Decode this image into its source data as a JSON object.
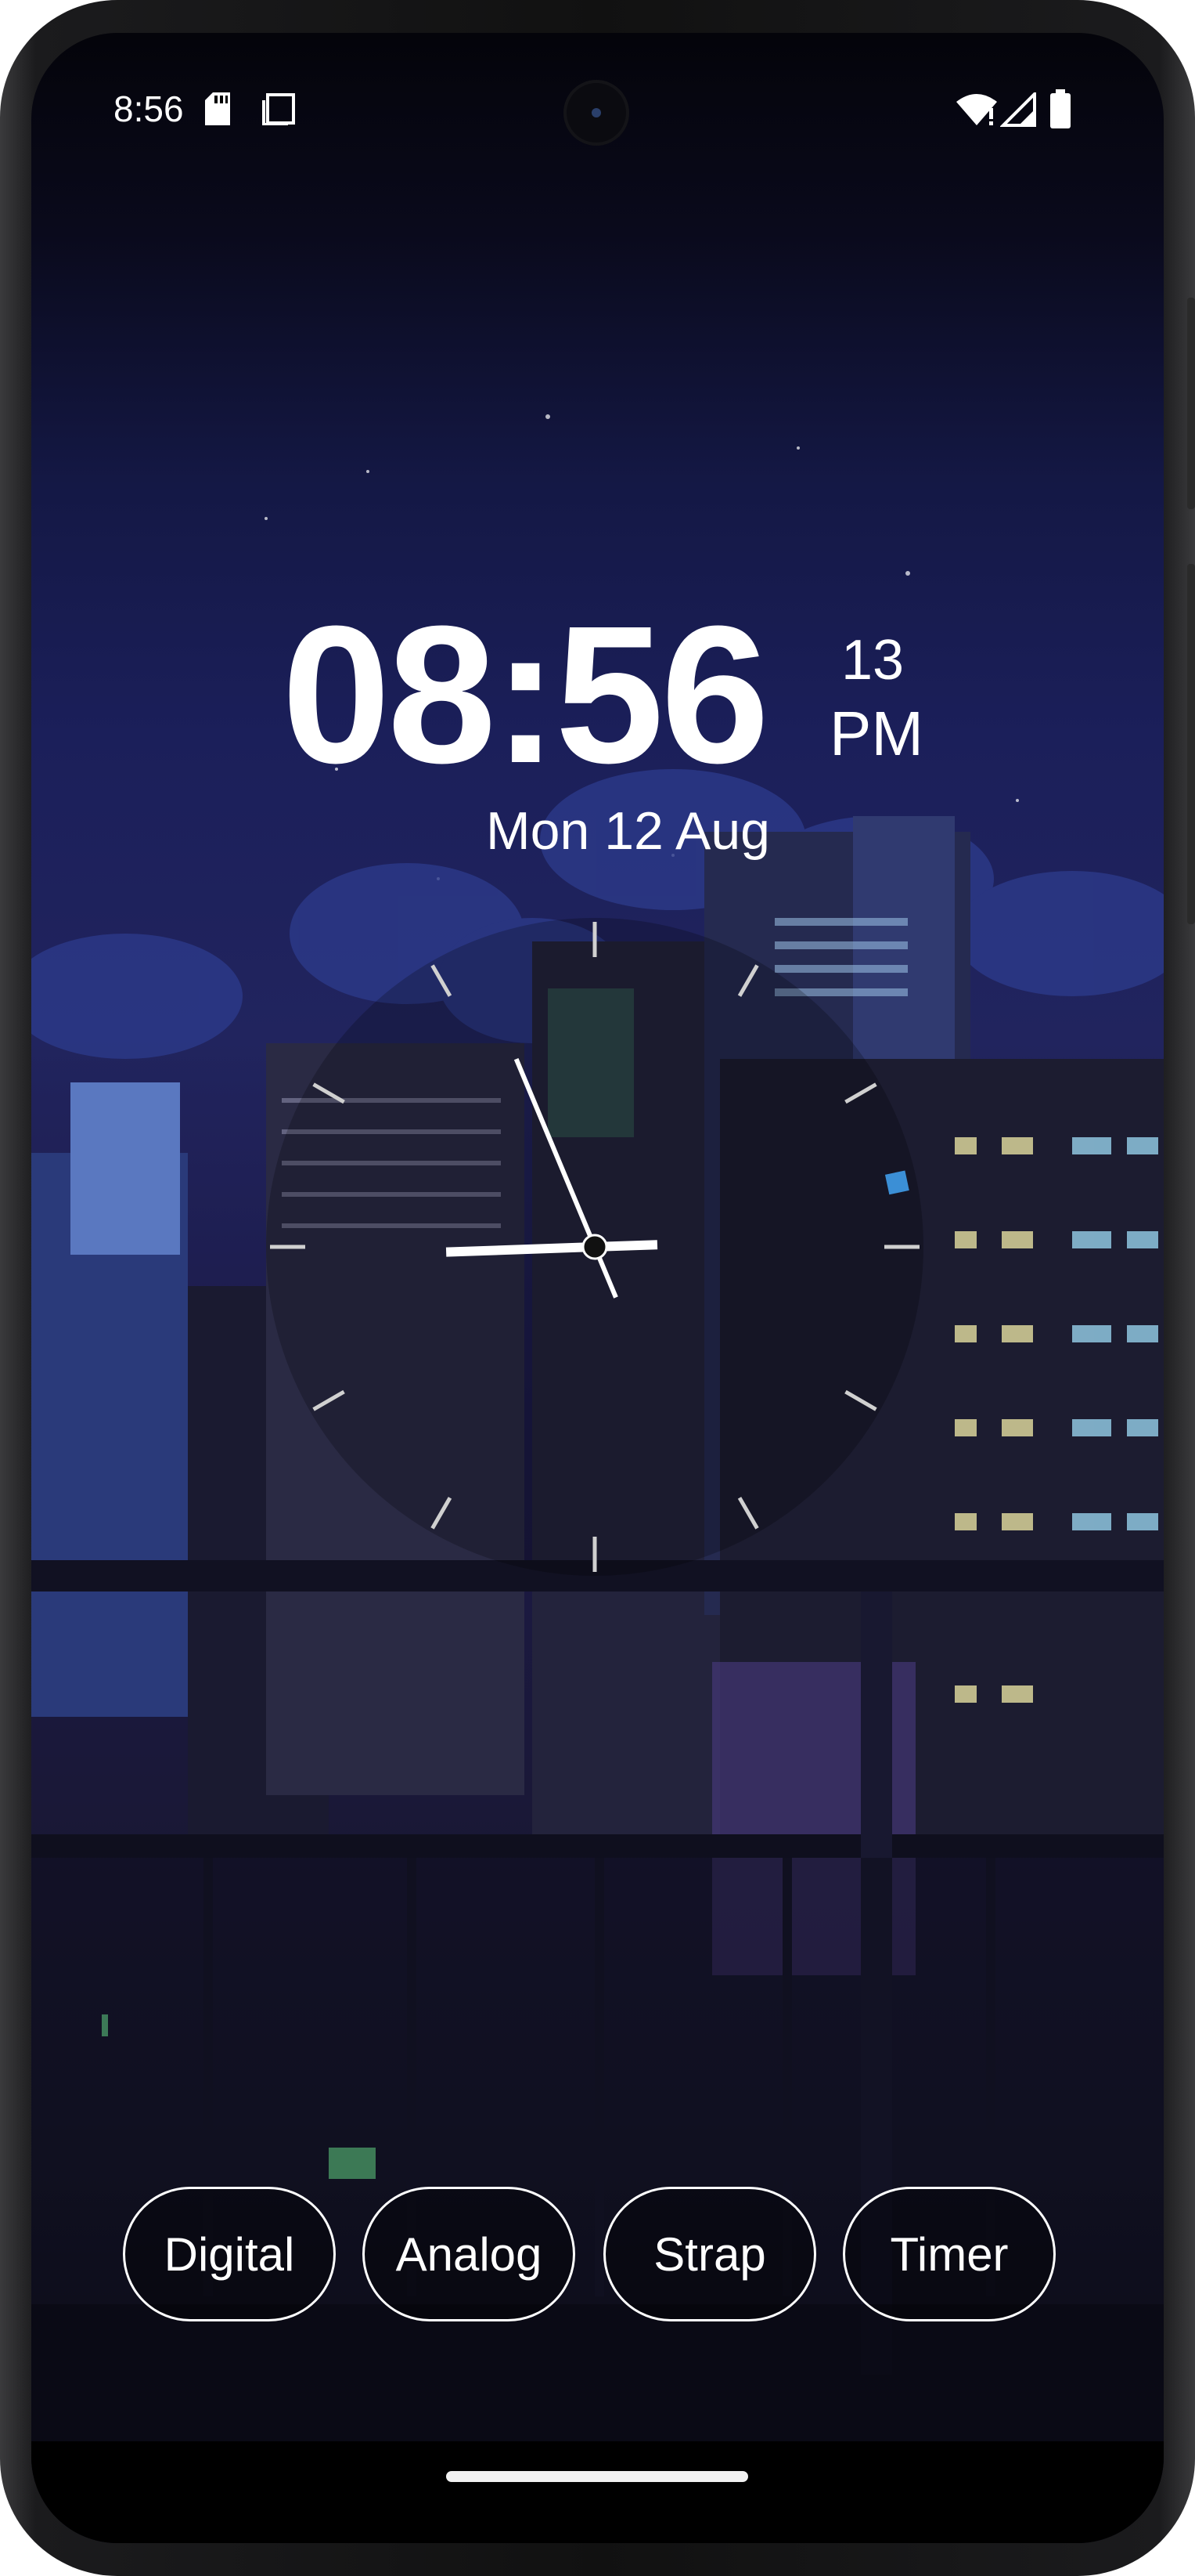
{
  "status_bar": {
    "time": "8:56",
    "icons": [
      "sd-card-icon",
      "screenshot-icon",
      "camera-cutout",
      "wifi-icon",
      "signal-icon",
      "battery-icon"
    ]
  },
  "clock": {
    "time": "08:56",
    "seconds": "13",
    "ampm": "PM",
    "date": "Mon 12 Aug",
    "analog": {
      "hour": 8,
      "minute": 56,
      "second": 13
    }
  },
  "modes": [
    {
      "label": "Digital"
    },
    {
      "label": "Analog"
    },
    {
      "label": "Strap"
    },
    {
      "label": "Timer"
    }
  ],
  "colors": {
    "text": "#ffffff",
    "second_marker": "#3b8fd6",
    "tick": "#d0d0d0"
  }
}
